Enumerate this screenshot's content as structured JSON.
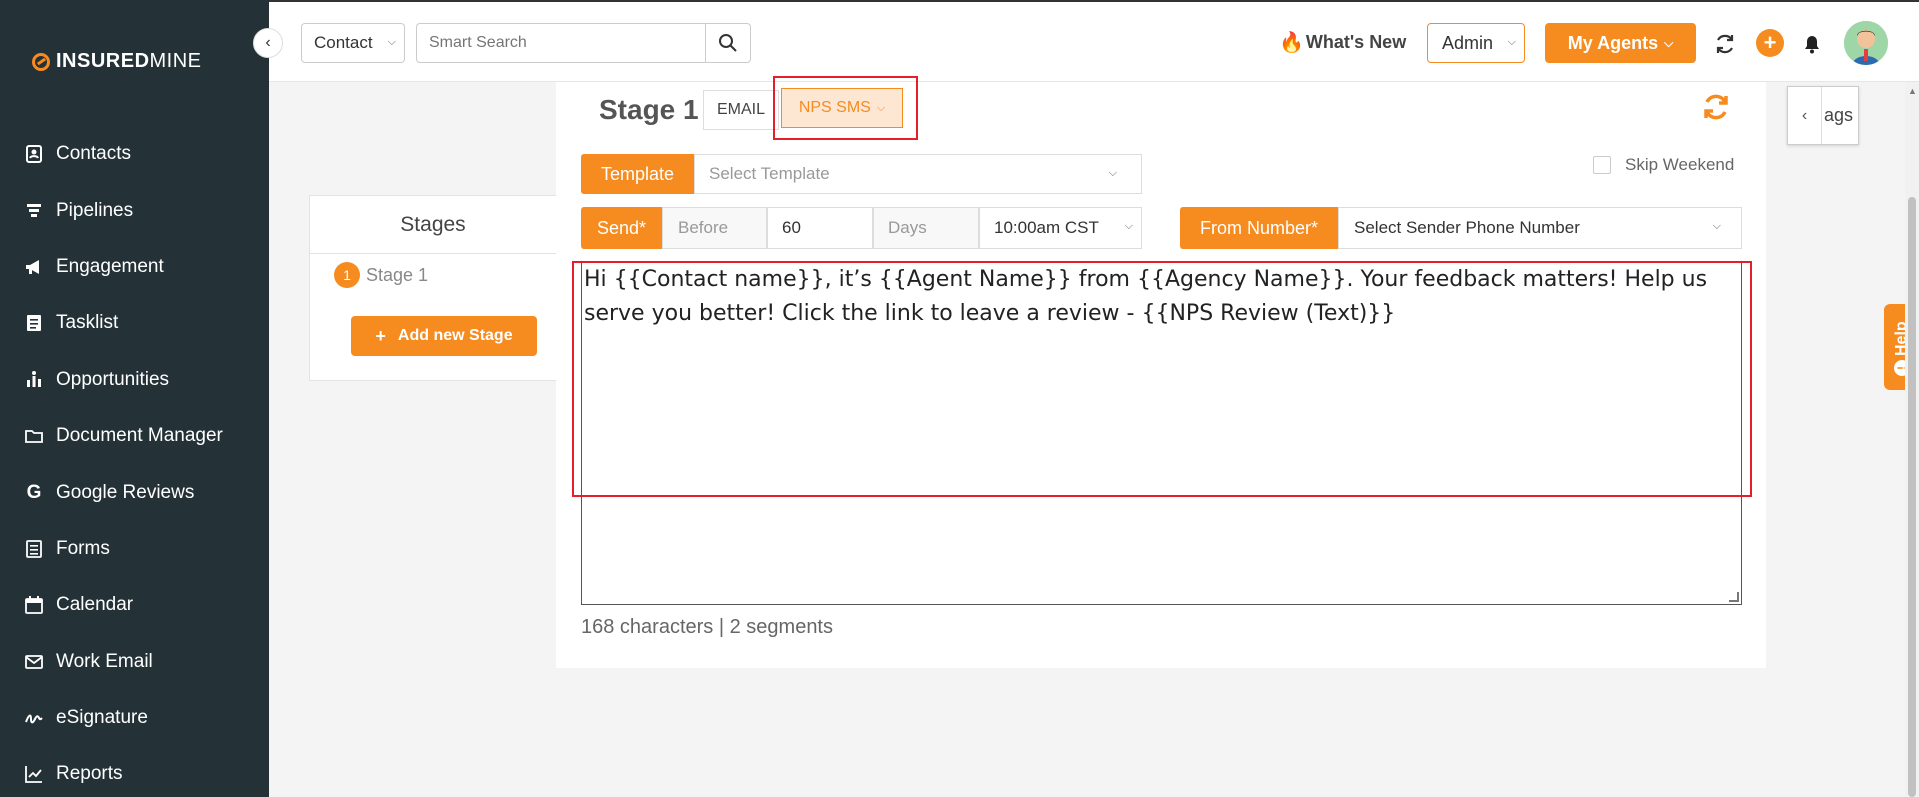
{
  "brand": {
    "part1": "INSURED",
    "part2": "MINE"
  },
  "sidebar": {
    "items": [
      {
        "label": "Contacts",
        "icon": "contacts-icon"
      },
      {
        "label": "Pipelines",
        "icon": "pipelines-icon"
      },
      {
        "label": "Engagement",
        "icon": "megaphone-icon"
      },
      {
        "label": "Tasklist",
        "icon": "tasklist-icon"
      },
      {
        "label": "Opportunities",
        "icon": "opportunities-icon"
      },
      {
        "label": "Document Manager",
        "icon": "folder-icon"
      },
      {
        "label": "Google Reviews",
        "icon": "google-icon"
      },
      {
        "label": "Forms",
        "icon": "forms-icon"
      },
      {
        "label": "Calendar",
        "icon": "calendar-icon"
      },
      {
        "label": "Work Email",
        "icon": "envelope-icon"
      },
      {
        "label": "eSignature",
        "icon": "signature-icon"
      },
      {
        "label": "Reports",
        "icon": "chart-icon"
      }
    ]
  },
  "topbar": {
    "scope": "Contact",
    "search_placeholder": "Smart Search",
    "whats_new": "What's New",
    "role": "Admin",
    "agents": "My Agents"
  },
  "stages": {
    "title": "Stages",
    "items": [
      {
        "number": "1",
        "label": "Stage 1"
      }
    ],
    "add_button": "Add new Stage"
  },
  "editor": {
    "stage_label": "Stage 1",
    "tab_email": "EMAIL",
    "tab_sms": "NPS SMS",
    "template_btn": "Template",
    "template_placeholder": "Select Template",
    "skip_weekend": "Skip Weekend",
    "send_btn": "Send*",
    "before": "Before",
    "days_value": "60",
    "days_label": "Days",
    "time": "10:00am CST",
    "from_btn": "From Number*",
    "from_placeholder": "Select Sender Phone Number",
    "message_line1": "Hi {{Contact name}}, it’s {{Agent Name}} from {{Agency Name}}. Your feedback matters! Help us",
    "message_line2": "serve you better! Click the link to leave a review - {{NPS Review (Text)}}",
    "char_count": "168 characters | 2 segments"
  },
  "right_panel": {
    "tags_label": "ags",
    "help": "Help"
  },
  "colors": {
    "accent": "#f68b1f",
    "sidebar_bg": "#243238",
    "highlight": "#e41e2b"
  }
}
